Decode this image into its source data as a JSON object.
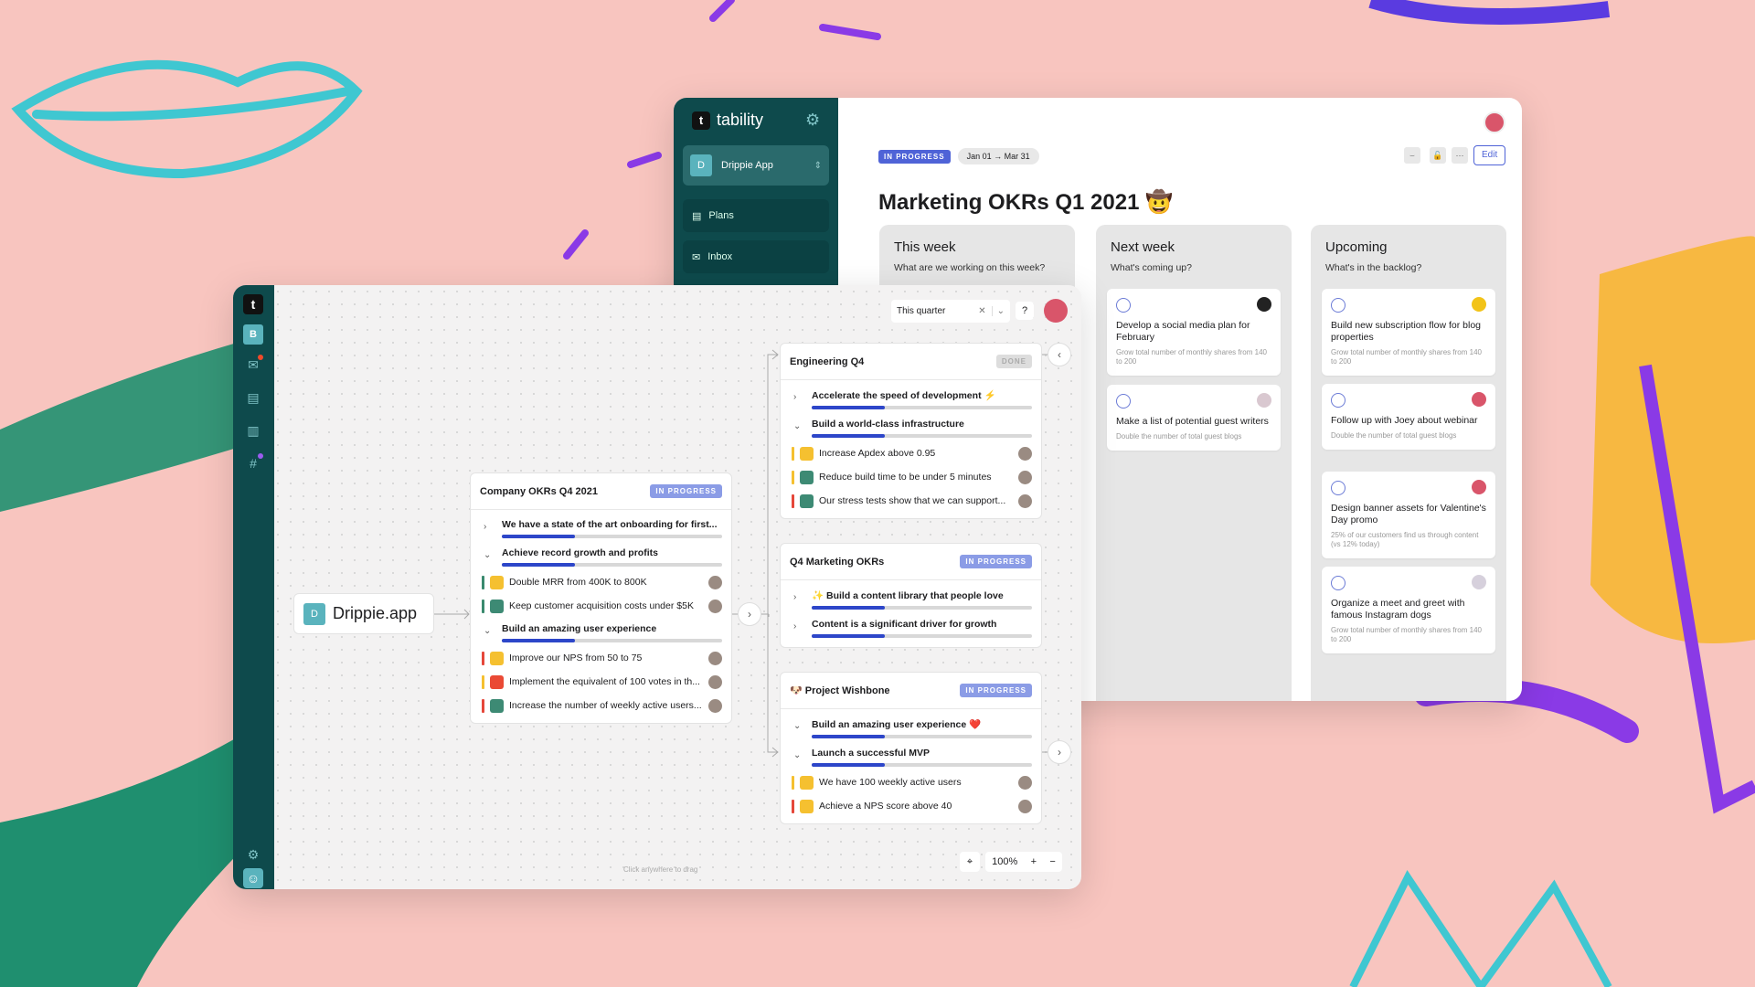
{
  "colors": {
    "background": "#f8c5bf",
    "sidebar": "#0e4a4c",
    "accent": "#4f63d7",
    "progress": "#2d46c9"
  },
  "back": {
    "brand": "tability",
    "workspace_initial": "D",
    "workspace": "Drippie App",
    "nav": [
      {
        "label": "Plans",
        "icon": "document-icon"
      },
      {
        "label": "Inbox",
        "icon": "inbox-icon"
      }
    ],
    "status": "IN PROGRESS",
    "dates": "Jan 01 → Mar 31",
    "edit": "Edit",
    "title": "Marketing OKRs Q1 2021 🤠",
    "columns": [
      {
        "title": "This week",
        "subtitle": "What are we working on this week?",
        "cards": []
      },
      {
        "title": "Next week",
        "subtitle": "What's coming up?",
        "cards": [
          {
            "title": "Develop a social media plan for February",
            "sub": "Grow total number of monthly shares from 140 to 200",
            "avatar": "#222"
          },
          {
            "title": "Make a list of potential guest writers",
            "sub": "Double the number of total guest blogs",
            "avatar": "#d9c8d0"
          }
        ]
      },
      {
        "title": "Upcoming",
        "subtitle": "What's in the backlog?",
        "cards": [
          {
            "title": "Build new subscription flow for blog properties",
            "sub": "Grow total number of monthly shares from 140 to 200",
            "avatar": "#f2c318"
          },
          {
            "title": "Follow up with Joey about webinar",
            "sub": "Double the number of total guest blogs",
            "avatar": "#d9556a"
          },
          {
            "title": "Design banner assets for Valentine's Day promo",
            "sub": "25% of our customers find us through content (vs 12% today)",
            "avatar": "#d9556a"
          },
          {
            "title": "Organize a meet and greet with famous Instagram dogs",
            "sub": "Grow total number of monthly shares from 140 to 200",
            "avatar": "#d6d0dc"
          }
        ]
      }
    ]
  },
  "front": {
    "sidebar_initial": "B",
    "filter": {
      "value": "This quarter"
    },
    "root": {
      "initial": "D",
      "label": "Drippie.app"
    },
    "drag_hint": "Click anywhere to drag",
    "zoom": "100%",
    "cards": [
      {
        "title": "Company OKRs Q4 2021",
        "status": "IN PROGRESS",
        "status_type": "light",
        "items": [
          {
            "type": "obj",
            "label": "We have a state of the art onboarding for first...",
            "progress": 33,
            "open": false
          },
          {
            "type": "obj",
            "label": "Achieve record growth and profits",
            "progress": 33,
            "open": true
          },
          {
            "type": "kr",
            "label": "Double MRR from 400K to 800K",
            "stripe": "#3a8a6e",
            "color": "#f5c030"
          },
          {
            "type": "kr",
            "label": "Keep customer acquisition costs under $5K",
            "stripe": "#3a8a6e",
            "color": "#3d8a74"
          },
          {
            "type": "obj",
            "label": "Build an amazing user experience",
            "progress": 33,
            "open": true
          },
          {
            "type": "kr",
            "label": "Improve our NPS from 50 to 75",
            "stripe": "#e5473a",
            "color": "#f5c030"
          },
          {
            "type": "kr",
            "label": "Implement the equivalent of 100 votes in th...",
            "stripe": "#f5c030",
            "color": "#ea4a35"
          },
          {
            "type": "kr",
            "label": "Increase the number of weekly active users...",
            "stripe": "#e5473a",
            "color": "#3d8a74"
          }
        ]
      },
      {
        "title": "Engineering Q4",
        "status": "DONE",
        "status_type": "done",
        "items": [
          {
            "type": "obj",
            "label": "Accelerate the speed of development ⚡",
            "progress": 33,
            "open": false
          },
          {
            "type": "obj",
            "label": "Build a world-class infrastructure",
            "progress": 33,
            "open": true
          },
          {
            "type": "kr",
            "label": "Increase Apdex above 0.95",
            "stripe": "#f5c030",
            "color": "#f5c030"
          },
          {
            "type": "kr",
            "label": "Reduce build time to be under 5 minutes",
            "stripe": "#f5c030",
            "color": "#3d8a74"
          },
          {
            "type": "kr",
            "label": "Our stress tests show that we can support...",
            "stripe": "#e5473a",
            "color": "#3d8a74"
          }
        ]
      },
      {
        "title": "Q4 Marketing OKRs",
        "status": "IN PROGRESS",
        "status_type": "light",
        "items": [
          {
            "type": "obj",
            "label": "✨ Build a content library that people love",
            "progress": 33,
            "open": false
          },
          {
            "type": "obj",
            "label": "Content is a significant driver for growth",
            "progress": 33,
            "open": false
          }
        ]
      },
      {
        "title": "🐶 Project Wishbone",
        "status": "IN PROGRESS",
        "status_type": "light",
        "items": [
          {
            "type": "obj",
            "label": "Build an amazing user experience ❤️",
            "progress": 33,
            "open": true
          },
          {
            "type": "obj",
            "label": "Launch a successful MVP",
            "progress": 33,
            "open": true
          },
          {
            "type": "kr",
            "label": "We have 100 weekly active users",
            "stripe": "#f5c030",
            "color": "#f5c030"
          },
          {
            "type": "kr",
            "label": "Achieve a NPS score above 40",
            "stripe": "#e5473a",
            "color": "#f5c030"
          }
        ]
      }
    ]
  }
}
